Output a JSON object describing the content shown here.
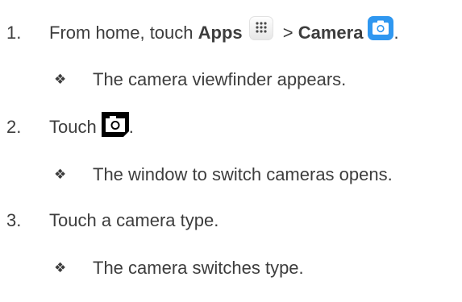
{
  "steps": [
    {
      "number": "1.",
      "prefix": "From home, touch ",
      "apps_label": "Apps",
      "separator": " > ",
      "camera_label": "Camera",
      "suffix": ".",
      "result": "The camera viewfinder appears."
    },
    {
      "number": "2.",
      "prefix": "Touch ",
      "suffix": ".",
      "result": "The window to switch cameras opens."
    },
    {
      "number": "3.",
      "prefix": "Touch a camera type.",
      "result": "The camera switches type."
    }
  ],
  "bullet_glyph": "❖",
  "icons": {
    "apps": "apps-grid-icon",
    "camera_app": "camera-app-icon",
    "switch_camera": "switch-camera-icon"
  },
  "colors": {
    "text": "#3d3d3d",
    "camera_app_blue": "#2f97f0"
  }
}
